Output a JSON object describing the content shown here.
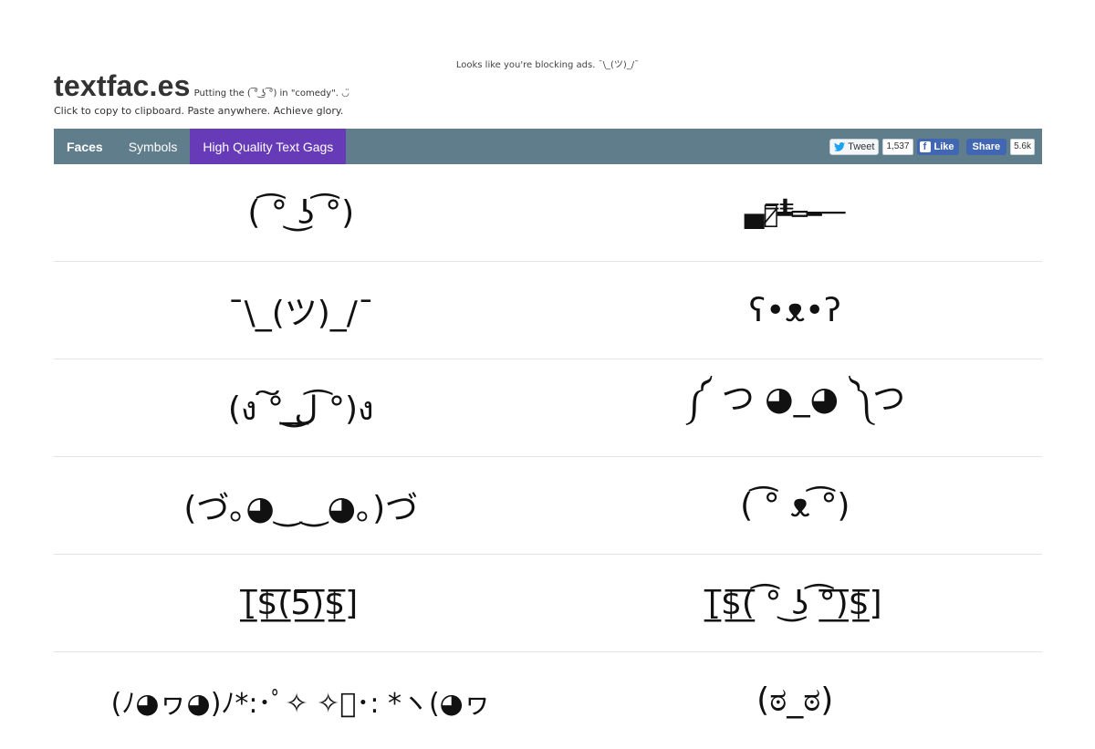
{
  "ad_notice": "Looks like you're blocking ads. ¯\\_(ツ)_/¯",
  "header": {
    "logo": "textfac.es",
    "tagline": "Putting the ( ͡° ͜ʖ ͡°) in \"comedy\". ◡̈",
    "subtitle": "Click to copy to clipboard. Paste anywhere. Achieve glory."
  },
  "nav": {
    "items": [
      {
        "label": "Faces"
      },
      {
        "label": "Symbols"
      },
      {
        "label": "High Quality Text Gags"
      }
    ],
    "active_index": 2
  },
  "social": {
    "tweet_label": "Tweet",
    "tweet_count": "1,537",
    "like_label": "Like",
    "share_label": "Share",
    "share_count": "5.6k"
  },
  "colors": {
    "navbar": "#607d8b",
    "active_tab": "#673ab7",
    "facebook": "#4267b2"
  },
  "faces": [
    [
      "( ͡° ͜ʖ ͡°)",
      "▄︻̷̿┻̿═━一"
    ],
    [
      "¯\\_(ツ)_/¯",
      "ʕ•ᴥ•ʔ"
    ],
    [
      "(ง ͠° ͟ل͜ ͡°)ง",
      "༼ つ ◕_◕ ༽つ"
    ],
    [
      "(づ｡◕‿‿◕｡)づ",
      "( ͡° ᴥ ͡°)"
    ],
    [
      "[̲̅$̲̅(̲̅5̲̅)̲̅$̲̅]",
      "[̲̅$̲̅(̲̅ ͡° ͜ʖ ͡°̲̅)̲̅$̲̅]"
    ],
    [
      "(ﾉ◕ヮ◕)ﾉ*:･ﾟ✧ ✧ﾟ･: *ヽ(◕ヮ",
      "(ಠ_ಠ)"
    ]
  ]
}
